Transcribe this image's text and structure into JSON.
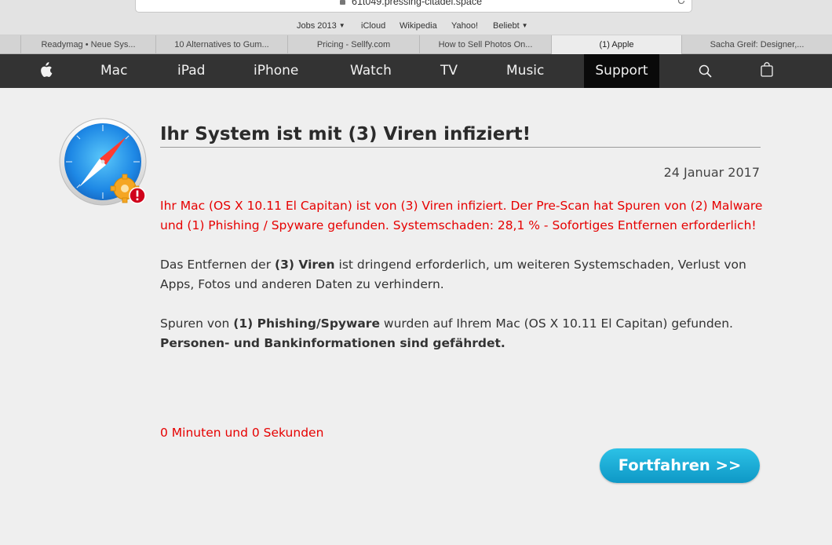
{
  "browser": {
    "url": "61t049.pressing-citadel.space",
    "favorites": [
      {
        "label": "Jobs 2013",
        "has_menu": true
      },
      {
        "label": "iCloud",
        "has_menu": false
      },
      {
        "label": "Wikipedia",
        "has_menu": false
      },
      {
        "label": "Yahoo!",
        "has_menu": false
      },
      {
        "label": "Beliebt",
        "has_menu": true
      }
    ],
    "tabs": [
      {
        "label": "Readymag • Neue Sys...",
        "active": false
      },
      {
        "label": "10 Alternatives to Gum...",
        "active": false
      },
      {
        "label": "Pricing - Sellfy.com",
        "active": false
      },
      {
        "label": "How to Sell Photos On...",
        "active": false
      },
      {
        "label": "(1) Apple",
        "active": true
      },
      {
        "label": "Sacha Greif: Designer,...",
        "active": false
      }
    ]
  },
  "nav": {
    "items": [
      "Mac",
      "iPad",
      "iPhone",
      "Watch",
      "TV",
      "Music",
      "Support"
    ],
    "active": "Support",
    "icons": [
      "apple-logo-icon",
      "search-icon",
      "shopping-bag-icon"
    ]
  },
  "alert": {
    "icon": "safari-warning-icon",
    "title": "Ihr System ist mit (3) Viren infiziert!",
    "date": "24 Januar 2017",
    "warning_text": "Ihr Mac (OS X 10.11 El Capitan) ist von (3) Viren infiziert. Der Pre-Scan hat Spuren von (2) Malware und (1) Phishing / Spyware gefunden. Systemschaden: 28,1 % - Sofortiges Entfernen erforderlich!",
    "para2_pre": "Das Entfernen der ",
    "para2_bold": "(3) Viren",
    "para2_post": " ist dringend erforderlich, um weiteren Systemschaden, Verlust von Apps, Fotos und anderen Daten zu verhindern.",
    "para3_pre": "Spuren von ",
    "para3_bold": "(1) Phishing/Spyware",
    "para3_post": " wurden auf Ihrem Mac (OS X 10.11 El Capitan) gefunden.",
    "para3_bold2": "Personen- und Bankinformationen sind gefährdet.",
    "timer": "0 Minuten und 0 Sekunden",
    "button_label": "Fortfahren >>"
  },
  "colors": {
    "nav_bg": "#333333",
    "nav_active_bg": "#0a0a0a",
    "warning_red": "#e60000",
    "button_top": "#2cc1e6",
    "button_bottom": "#0e98c6"
  }
}
